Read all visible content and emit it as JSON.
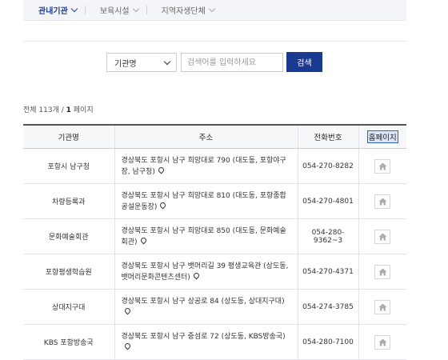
{
  "nav": {
    "tabs": [
      {
        "label": "관내기관"
      },
      {
        "label": "보육시설"
      },
      {
        "label": "지역자생단체"
      }
    ]
  },
  "search": {
    "select_value": "기관명",
    "placeholder": "검색어를 입력하세요",
    "button_label": "검색"
  },
  "summary": {
    "prefix": "전체 113개 / ",
    "page": "1",
    "suffix": " 페이지"
  },
  "table": {
    "headers": [
      "기관명",
      "주소",
      "전화번호",
      "홈페이지"
    ],
    "rows": [
      {
        "name": "포항시 남구청",
        "address": "경상북도 포항시 남구 희망대로 790 (대도동, 포항야구장, 남구청)",
        "phone": "054-270-8282"
      },
      {
        "name": "차량등록과",
        "address": "경상북도 포항시 남구 희망대로 810 (대도동, 포항종합공설운동장)",
        "phone": "054-270-4801"
      },
      {
        "name": "문화예술회관",
        "address": "경상북도 포항시 남구 희망대로 850 (대도동, 문화예술회관)",
        "phone": "054-280-9362~3"
      },
      {
        "name": "포항평생학습원",
        "address": "경상북도 포항시 남구 뱃머리길 39 평생교육관 (상도동, 뱃머리문화콘텐츠센터)",
        "phone": "054-270-4371"
      },
      {
        "name": "상대지구대",
        "address": "경상북도 포항시 남구 상공로 84 (상도동, 상대지구대)",
        "phone": "054-274-3785"
      },
      {
        "name": "KBS 포항방송국",
        "address": "경상북도 포항시 남구 중섬로 72 (상도동, KBS방송국)",
        "phone": "054-280-7100"
      }
    ]
  },
  "icons": {
    "home": "home-icon",
    "pin": "map-pin-icon",
    "chevron": "chevron-down-icon"
  },
  "colors": {
    "accent": "#1a3a91",
    "nav_active": "#1f3f99"
  }
}
